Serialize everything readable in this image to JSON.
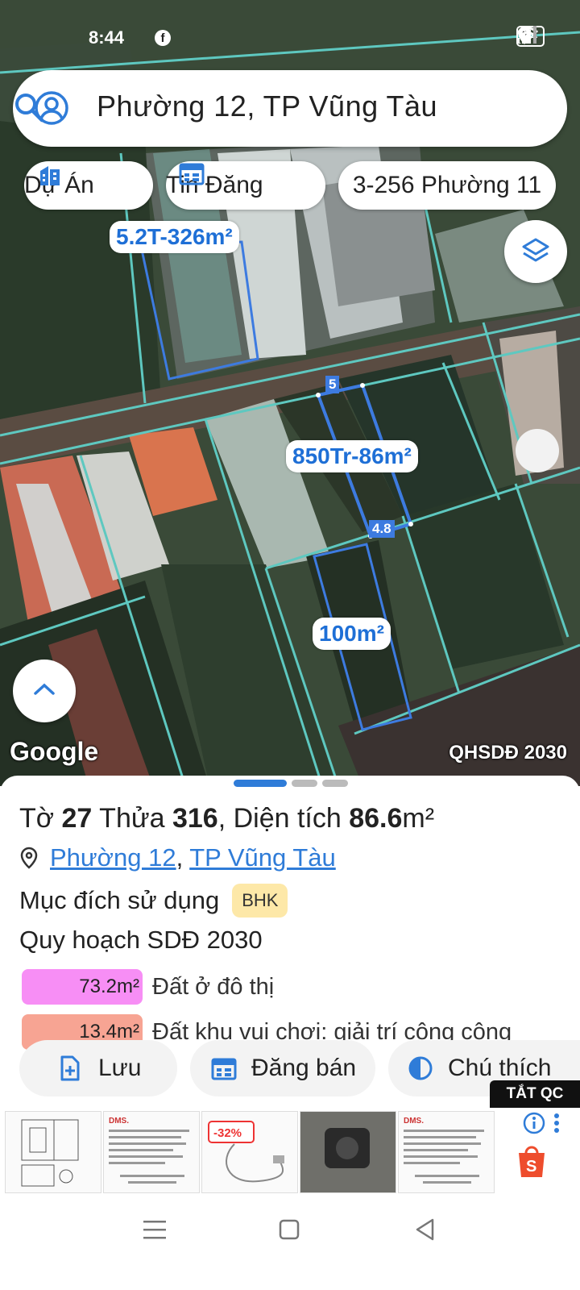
{
  "status_bar": {
    "time": "8:44",
    "battery": "74"
  },
  "search": {
    "location_text": "Phường 12, TP Vũng Tàu"
  },
  "filter_chips": [
    {
      "label": "Dự Án",
      "icon": "building-icon"
    },
    {
      "label": "Tin Đăng",
      "icon": "calendar-icon"
    },
    {
      "label": "3-256 Phường 11",
      "icon": ""
    }
  ],
  "map": {
    "labels": {
      "listing_top_left": "5.2T-326m²",
      "listing_selected": "850Tr-86m²",
      "lot_below": "100m²",
      "dimension_top": "5",
      "dimension_side": "4.8"
    },
    "google_logo": "Google",
    "layer_name": "QHSDĐ 2030"
  },
  "parcel": {
    "title_prefix": "Tờ ",
    "sheet_no": "27",
    "title_mid": " Thửa ",
    "parcel_no": "316",
    "title_area_prefix": ", Diện tích ",
    "area": "86.6",
    "area_unit": "m²",
    "ward": "Phường 12",
    "separator": ",",
    "city": "TP Vũng Tàu",
    "purpose_label": "Mục đích sử dụng",
    "purpose_code": "BHK",
    "plan_label": "Quy hoạch SDĐ 2030",
    "land_uses": [
      {
        "area": "73.2m²",
        "desc": "Đất ở đô thị",
        "color": "#f78ef5"
      },
      {
        "area": "13.4m²",
        "desc": "Đất khu vui chơi: giải trí công cộng",
        "color": "#f7a493"
      }
    ]
  },
  "actions": {
    "save": "Lưu",
    "post_sale": "Đăng bán",
    "legend": "Chú thích"
  },
  "ad": {
    "hide_label": "TẮT QC",
    "discount": "-32%"
  },
  "colors": {
    "accent": "#2f7cd8",
    "parcel_outline": "#5ec8c0",
    "selected_outline": "#3d7be0"
  }
}
